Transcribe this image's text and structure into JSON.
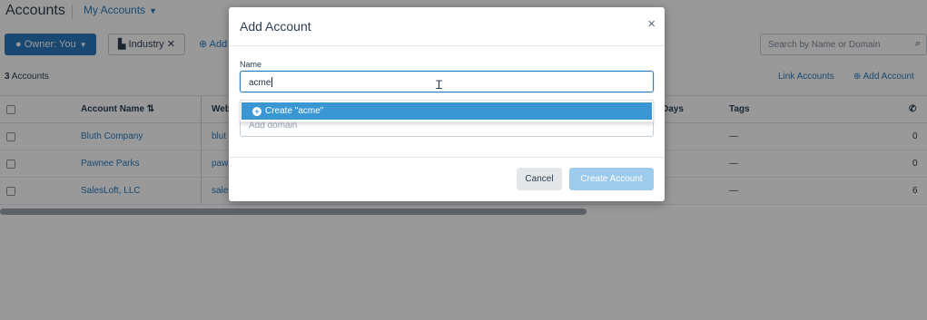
{
  "header": {
    "title": "Accounts",
    "view": "My Accounts",
    "chevron_icon": "chevron-down-icon"
  },
  "toolbar": {
    "owner_filter": "Owner: You",
    "industry_filter": "Industry",
    "add_filter": "Add",
    "search_placeholder": "Search by Name or Domain"
  },
  "summary": {
    "count": "3",
    "count_label": "Accounts",
    "link_accounts": "Link Accounts",
    "add_account": "Add Account"
  },
  "table": {
    "headers": {
      "account_name": "Account Name",
      "website": "Web",
      "days": "Days",
      "tags": "Tags"
    },
    "rows": [
      {
        "name": "Bluth Company",
        "website": "blut",
        "tags": "—",
        "calls": "0"
      },
      {
        "name": "Pawnee Parks",
        "website": "paw",
        "tags": "—",
        "calls": "0"
      },
      {
        "name": "SalesLoft, LLC",
        "website": "sale",
        "tags": "—",
        "calls": "6"
      }
    ]
  },
  "modal": {
    "title": "Add Account",
    "close": "×",
    "name_label": "Name",
    "name_value": "acme",
    "dropdown_option": "Create \"acme\"",
    "domain_placeholder": "Add domain",
    "cancel": "Cancel",
    "create": "Create Account"
  },
  "colors": {
    "accent": "#2b7bbf",
    "dropdown_highlight": "#3b97d3",
    "create_disabled": "#9ccbec"
  }
}
